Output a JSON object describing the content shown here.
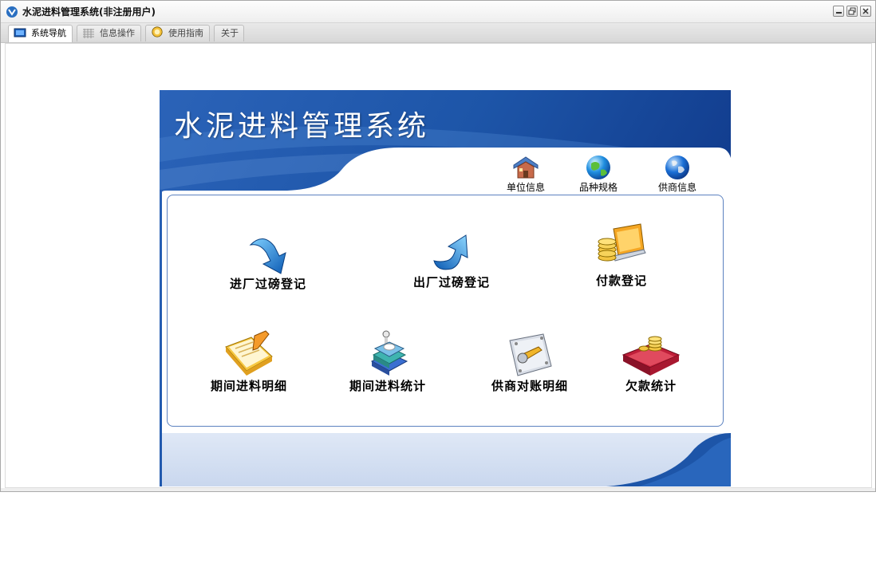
{
  "window": {
    "title": "水泥进料管理系统(非注册用户)",
    "controls": [
      "minimize-icon",
      "restore-icon",
      "close-icon"
    ]
  },
  "tabs": [
    {
      "label": "系统导航",
      "icon": "monitor-icon",
      "active": true
    },
    {
      "label": "信息操作",
      "icon": "grid-icon",
      "active": false
    },
    {
      "label": "使用指南",
      "icon": "help-icon",
      "active": false
    },
    {
      "label": "关于",
      "icon": "",
      "active": false
    }
  ],
  "banner": {
    "title": "水泥进料管理系统"
  },
  "quick_links": [
    {
      "label": "单位信息",
      "icon": "house-icon"
    },
    {
      "label": "品种规格",
      "icon": "globe-icon"
    },
    {
      "label": "供商信息",
      "icon": "earth-icon"
    }
  ],
  "functions": [
    {
      "label": "进厂过磅登记",
      "icon": "arrow-down-icon"
    },
    {
      "label": "出厂过磅登记",
      "icon": "arrow-up-icon"
    },
    {
      "label": "付款登记",
      "icon": "coins-laptop-icon"
    },
    {
      "label": "期间进料明细",
      "icon": "notepad-pencil-icon"
    },
    {
      "label": "期间进料统计",
      "icon": "book-stack-icon"
    },
    {
      "label": "供商对账明细",
      "icon": "wrench-panel-icon"
    },
    {
      "label": "欠款统计",
      "icon": "red-book-coins-icon"
    }
  ],
  "colors": {
    "banner_blue": "#1f4f9e",
    "banner_light": "#d3def0",
    "card_border": "#5c82c0"
  }
}
